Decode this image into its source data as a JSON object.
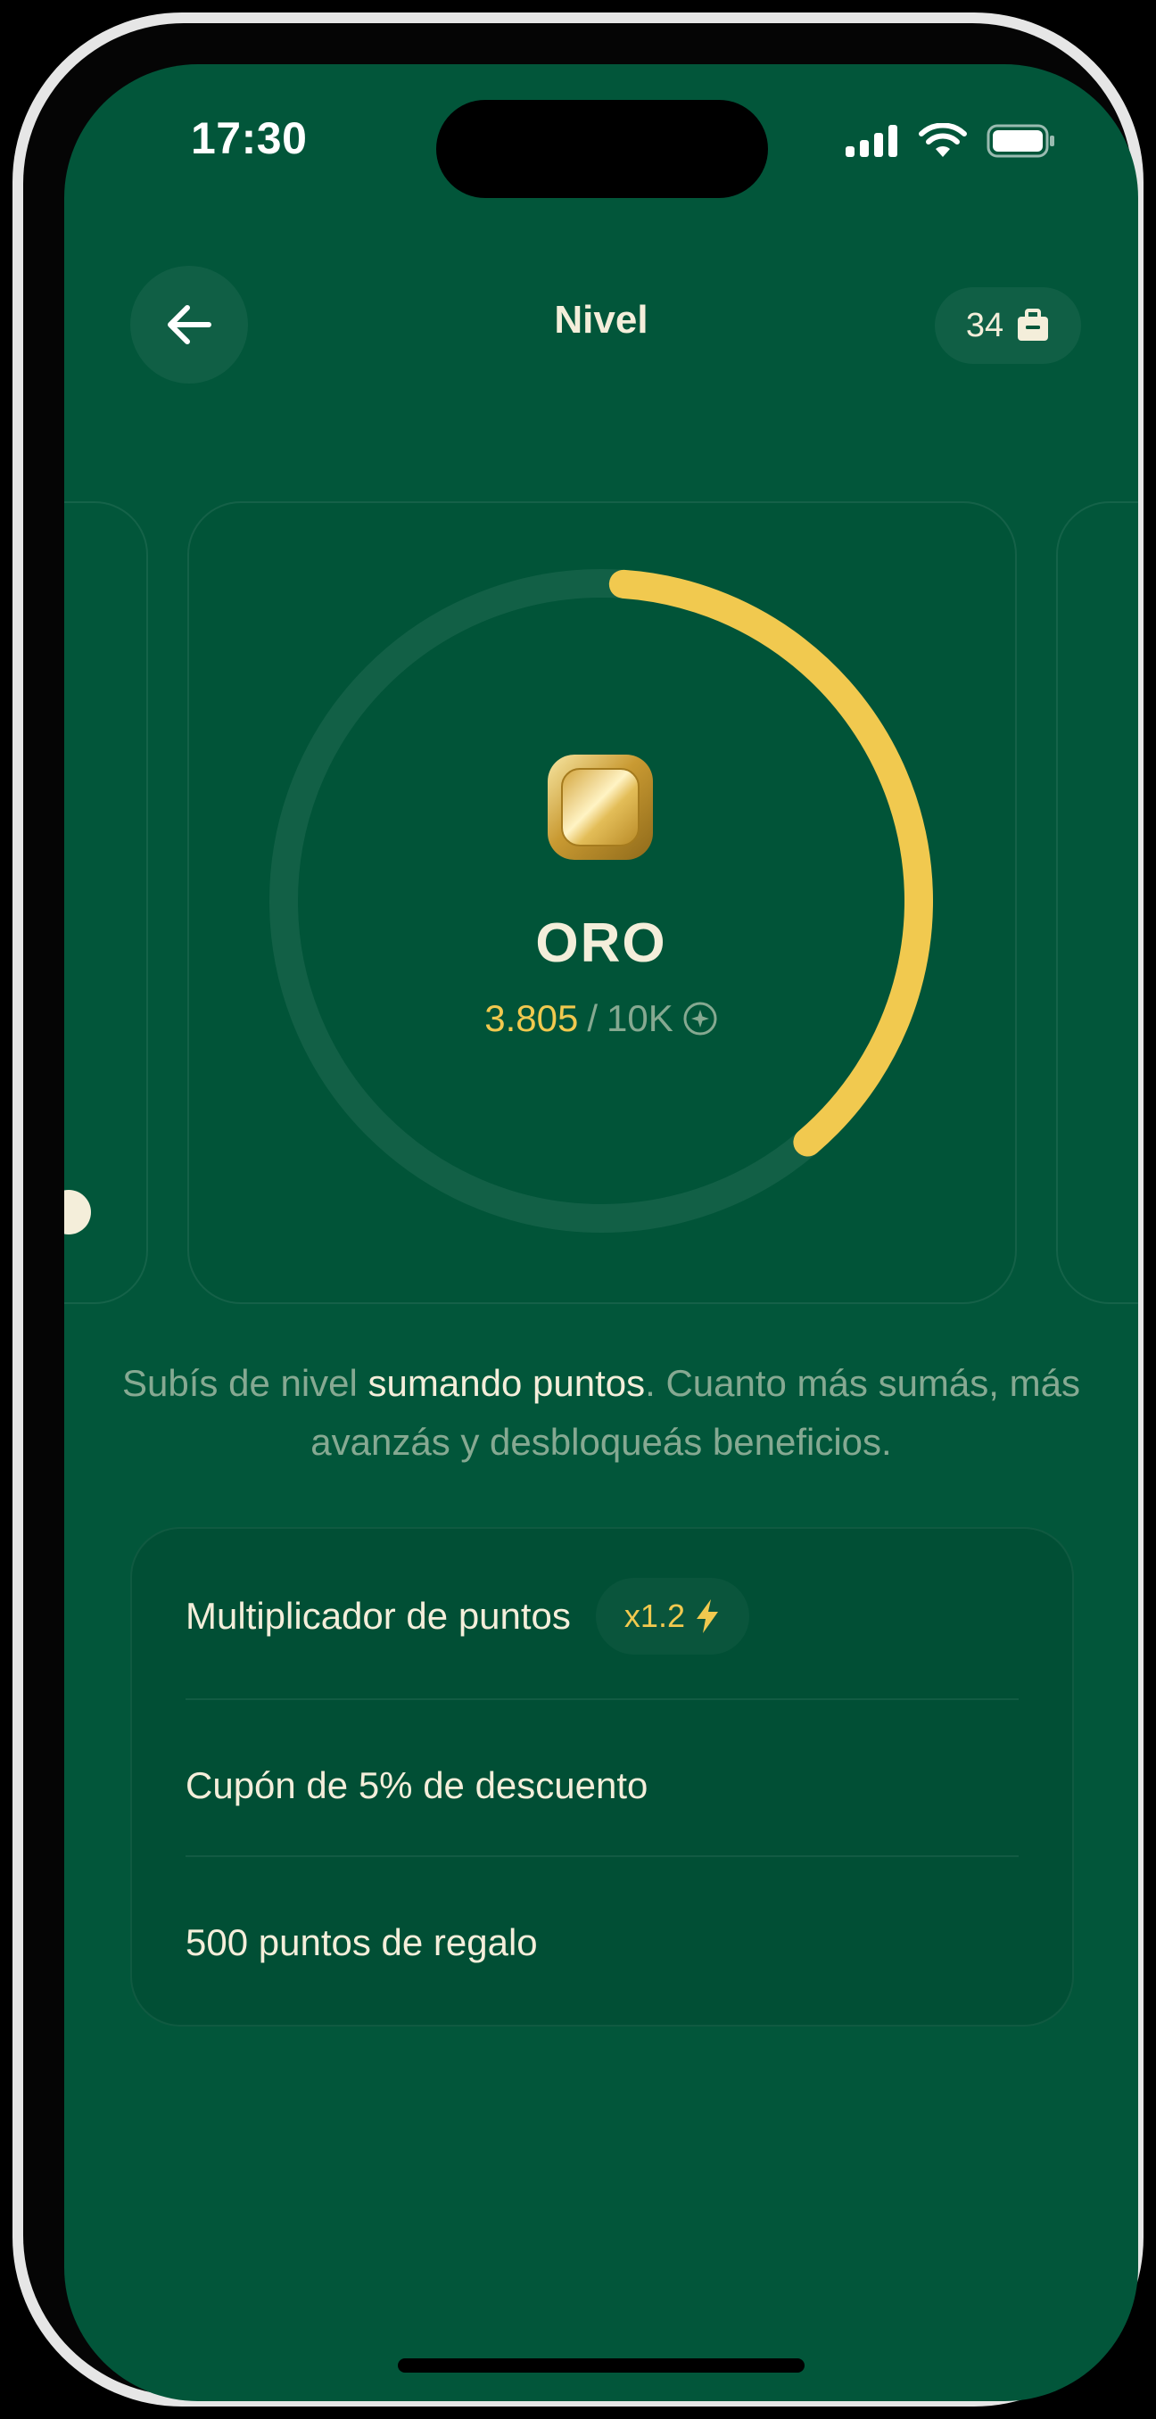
{
  "status_bar": {
    "time": "17:30"
  },
  "header": {
    "title": "Nivel",
    "wallet_count": "34"
  },
  "level": {
    "name": "ORO",
    "points_current": "3.805",
    "points_separator": "/",
    "points_goal": "10K",
    "progress_fraction": 0.3805
  },
  "description": {
    "part1": "Subís de nivel ",
    "highlight": "sumando puntos",
    "part2": ". Cuanto más sumás, más avanzás y desbloqueás beneficios."
  },
  "benefits": [
    {
      "label": "Multiplicador de puntos",
      "badge": "x1.2"
    },
    {
      "label": "Cupón de 5% de descuento"
    },
    {
      "label": "500 puntos de regalo"
    }
  ],
  "colors": {
    "background": "#02563a",
    "accent": "#f1c94f",
    "text": "#f4eeda"
  },
  "icons": {
    "back": "arrow-left-icon",
    "wallet": "briefcase-icon",
    "points": "star-circle-icon",
    "multiplier": "lightning-bolt-icon",
    "badge": "gold-badge-icon"
  }
}
